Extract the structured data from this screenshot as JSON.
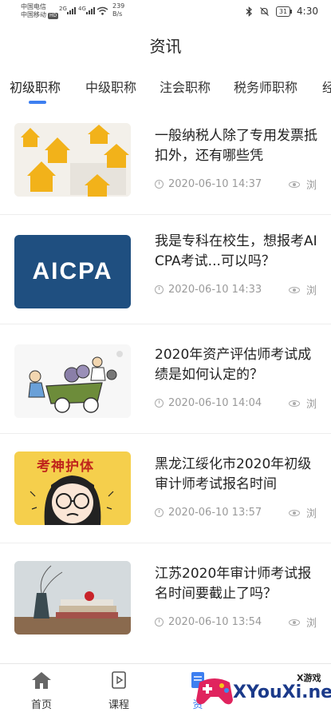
{
  "status_bar": {
    "carrier_1": "中国电信",
    "carrier_2": "中国移动",
    "hd_badge": "HD",
    "sig_1": "2G",
    "sig_2": "4G",
    "net_speed_value": "239",
    "net_speed_unit": "B/s",
    "battery": "31",
    "time": "4:30"
  },
  "header": {
    "title": "资讯"
  },
  "tabs": [
    {
      "label": "初级职称",
      "active": true
    },
    {
      "label": "中级职称",
      "active": false
    },
    {
      "label": "注会职称",
      "active": false
    },
    {
      "label": "税务师职称",
      "active": false
    },
    {
      "label": "经",
      "active": false
    }
  ],
  "articles": [
    {
      "title": "一般纳税人除了专用发票抵扣外，还有哪些凭",
      "date": "2020-06-10 14:37",
      "views_label": "浏",
      "thumb": "houses-icon"
    },
    {
      "title": "我是专科在校生，想报考AICPA考试...可以吗？",
      "date": "2020-06-10 14:33",
      "views_label": "浏",
      "thumb": "aicpa-logo",
      "thumb_text": "AICPA"
    },
    {
      "title": "2020年资产评估师考试成绩是如何认定的？",
      "date": "2020-06-10 14:04",
      "views_label": "浏",
      "thumb": "cart-cartoon"
    },
    {
      "title": "黑龙江绥化市2020年初级审计师考试报名时间",
      "date": "2020-06-10 13:57",
      "views_label": "浏",
      "thumb": "exam-girl-cartoon",
      "thumb_text": "考神护体"
    },
    {
      "title": "江苏2020年审计师考试报名时间要截止了吗？",
      "date": "2020-06-10 13:54",
      "views_label": "浏",
      "thumb": "books-photo"
    }
  ],
  "bottom_nav": [
    {
      "label": "首页",
      "icon": "home-icon"
    },
    {
      "label": "课程",
      "icon": "course-icon"
    },
    {
      "label": "资",
      "icon": "news-icon"
    }
  ],
  "watermark": {
    "text": "XYouXi.net",
    "small": "X游戏"
  },
  "colors": {
    "accent": "#3d7ff0",
    "aicpa_bg": "#1f4f80",
    "watermark": "#1b3a8a"
  }
}
